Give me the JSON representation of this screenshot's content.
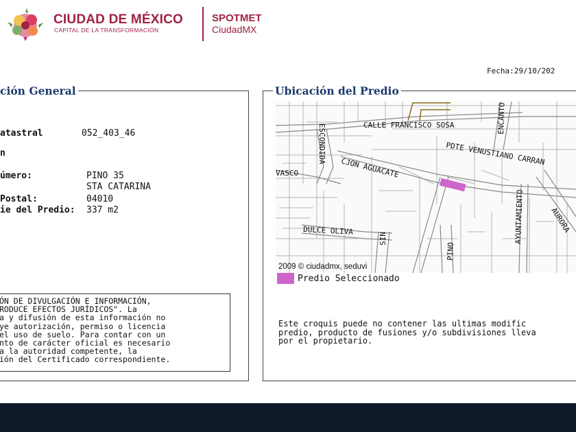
{
  "header": {
    "logo_title": "CIUDAD DE MÉXICO",
    "logo_subtitle": "CAPITAL DE LA TRANSFORMACIÓN",
    "app_title": "SPOTMET",
    "app_subtitle": "CiudadMX",
    "colors": {
      "brand": "#9f2241"
    }
  },
  "date_label": "Fecha:29/10/202",
  "general": {
    "title": "ción General",
    "cuenta_label": "atastral",
    "cuenta_value": "052_403_46",
    "extra_label": "n",
    "domicilio_label": "úmero:",
    "domicilio_street": "PINO 35",
    "colonia": "STA CATARINA",
    "cp_label": "Postal:",
    "cp_value": "04010",
    "superficie_label": "ie del Predio:",
    "superficie_value": "337 m2",
    "disclaimer_lines": [
      "ÓN DE DIVULGACIÓN E INFORMACIÓN,",
      "RODUCE  EFECTOS  JURÍDICOS\".  La",
      "a  y  difusión  de  esta  información  no",
      "ye  autorización,  permiso  o  licencia",
      "el  uso  de  suelo.  Para  contar  con  un",
      "nto  de  carácter  oficial  es  necesario",
      "  a  la  autoridad  competente,  la",
      "ión del Certificado correspondiente."
    ]
  },
  "location": {
    "title": "Ubicación del Predio",
    "streets": {
      "calle_francisco_sosa": "CALLE FRANCISCO SOSA",
      "encanto": "ENCANTO",
      "escondida": "ESCONDIDA",
      "pdte_venustiano": "PDTE VENUSTIANO CARRAN",
      "cjon_aguacate": "CJON AGUACATE",
      "vasco": "VASCO",
      "dulce_oliva": "DULCE OLIVA",
      "sin": "SIN",
      "pino": "PINO",
      "ayuntamiento": "AYUNTAMIENTO",
      "aurora": "AURORA"
    },
    "map_credit": "2009 © ciudadmx, seduvi",
    "legend_label": "Predio Seleccionado",
    "legend_color": "#cc66cc",
    "note_lines": [
      "Este croquis puede no contener las ultimas modific",
      "predio, producto de fusiones y/o subdivisiones lleva",
      "por el propietario."
    ]
  }
}
